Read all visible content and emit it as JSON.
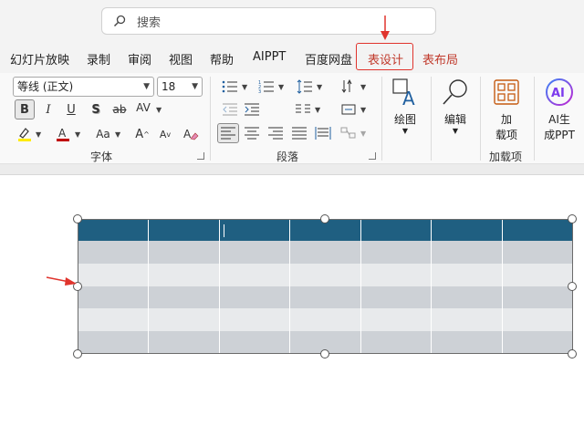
{
  "search": {
    "placeholder": "搜索",
    "icon": "search-icon"
  },
  "tabs": [
    {
      "label": "幻灯片放映"
    },
    {
      "label": "录制"
    },
    {
      "label": "审阅"
    },
    {
      "label": "视图"
    },
    {
      "label": "帮助"
    },
    {
      "label": "AIPPT"
    },
    {
      "label": "百度网盘"
    },
    {
      "label": "表设计",
      "color": "#c0392b",
      "highlighted": true
    },
    {
      "label": "表布局",
      "color": "#c0392b"
    }
  ],
  "font_group": {
    "font_name": "等线 (正文)",
    "font_size": "18",
    "label": "字体",
    "bold": "B",
    "italic": "I",
    "underline": "U",
    "shadow": "S",
    "strikethrough": "ab",
    "spacing": "AV",
    "change_case": "Aa",
    "grow_font": "A",
    "shrink_font": "A",
    "highlight_color": "#ffeb00",
    "font_color": "#c00000"
  },
  "paragraph_group": {
    "label": "段落"
  },
  "drawing": {
    "label": "绘图"
  },
  "editing": {
    "label": "编辑"
  },
  "addins_button": {
    "line1": "加",
    "line2": "载项"
  },
  "addins_group": {
    "label": "加载项"
  },
  "ai_button": {
    "line1": "AI生",
    "line2": "成PPT",
    "icon_text": "AI"
  },
  "table": {
    "columns": 7,
    "rows": [
      "head",
      "dark",
      "light",
      "dark",
      "light",
      "dark"
    ],
    "header_color": "#1f5f81",
    "band_dark": "#cdd1d6",
    "band_light": "#e8eaec"
  },
  "annotations": {
    "arrow_color": "#e0342d"
  }
}
